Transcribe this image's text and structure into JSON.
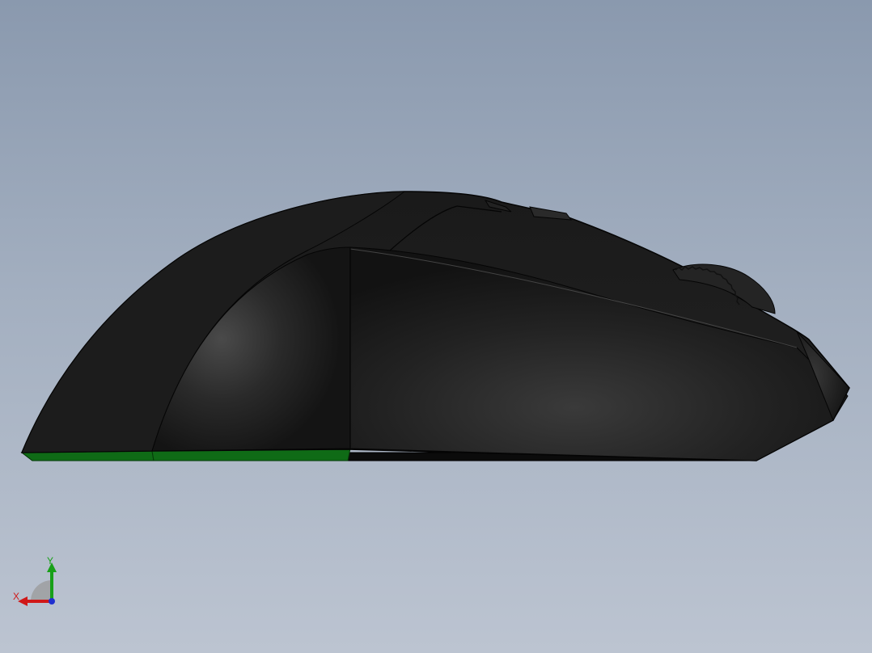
{
  "view": {
    "background_top": "#8a99ae",
    "background_bottom": "#bcc4d1"
  },
  "model": {
    "body_color": "#1b1b1b",
    "skate_color": "#0f6b16"
  },
  "triad": {
    "x_label": "X",
    "y_label": "Y",
    "x_color": "#d01818",
    "y_color": "#18a018",
    "z_color": "#2030d0"
  }
}
